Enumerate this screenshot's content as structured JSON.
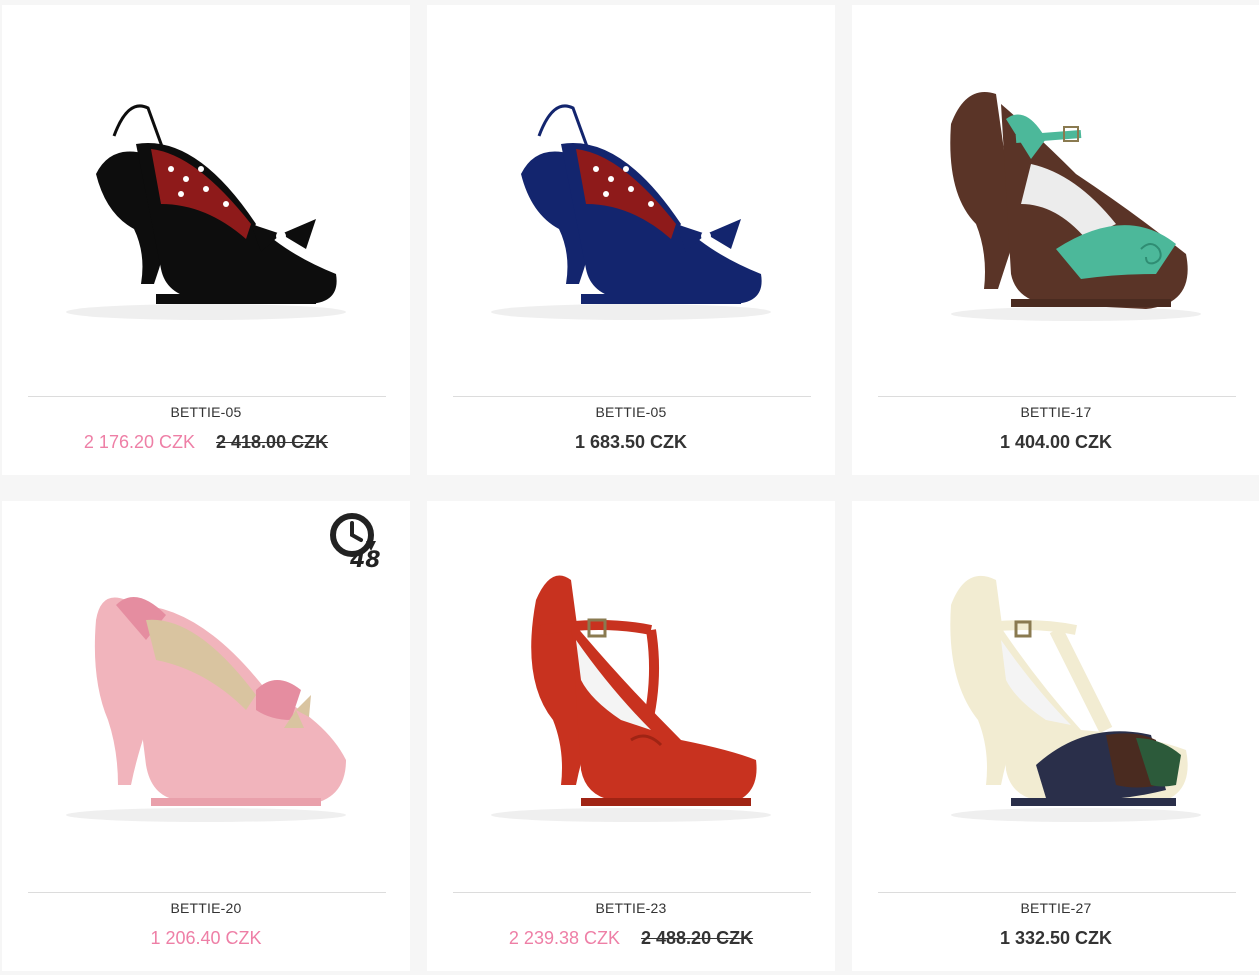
{
  "products": [
    {
      "name": "BETTIE-05",
      "price": "2 176.20 CZK",
      "old_price": "2 418.00 CZK",
      "on_sale": true,
      "colors": {
        "main": "#0d0d0d",
        "trim": "#ffffff",
        "lining": "#8e1a1a"
      }
    },
    {
      "name": "BETTIE-05",
      "price": "1 683.50 CZK",
      "old_price": "",
      "on_sale": false,
      "colors": {
        "main": "#13256e",
        "trim": "#ffffff",
        "lining": "#8e1a1a"
      }
    },
    {
      "name": "BETTIE-17",
      "price": "1 404.00 CZK",
      "old_price": "",
      "on_sale": false,
      "colors": {
        "main": "#5a3427",
        "trim": "#4cb89a",
        "lining": "#ececec"
      }
    },
    {
      "name": "BETTIE-20",
      "price": "1 206.40 CZK",
      "old_price": "",
      "on_sale": true,
      "badge": "48",
      "colors": {
        "main": "#f1b4bc",
        "trim": "#d9c4a0",
        "lining": "#f4f4f4"
      }
    },
    {
      "name": "BETTIE-23",
      "price": "2 239.38 CZK",
      "old_price": "2 488.20 CZK",
      "on_sale": true,
      "colors": {
        "main": "#c8321f",
        "trim": "#c8321f",
        "lining": "#f4f4f4"
      }
    },
    {
      "name": "BETTIE-27",
      "price": "1 332.50 CZK",
      "old_price": "",
      "on_sale": false,
      "colors": {
        "main": "#f2ecd2",
        "trim": "#2a2f4a",
        "lining": "#f4f4f4"
      }
    }
  ],
  "badge_icon": "clock-48h-delivery-icon",
  "colors": {
    "sale_price": "#ee7fa6",
    "regular_price": "#333333",
    "background": "#f6f6f6",
    "card": "#ffffff"
  }
}
